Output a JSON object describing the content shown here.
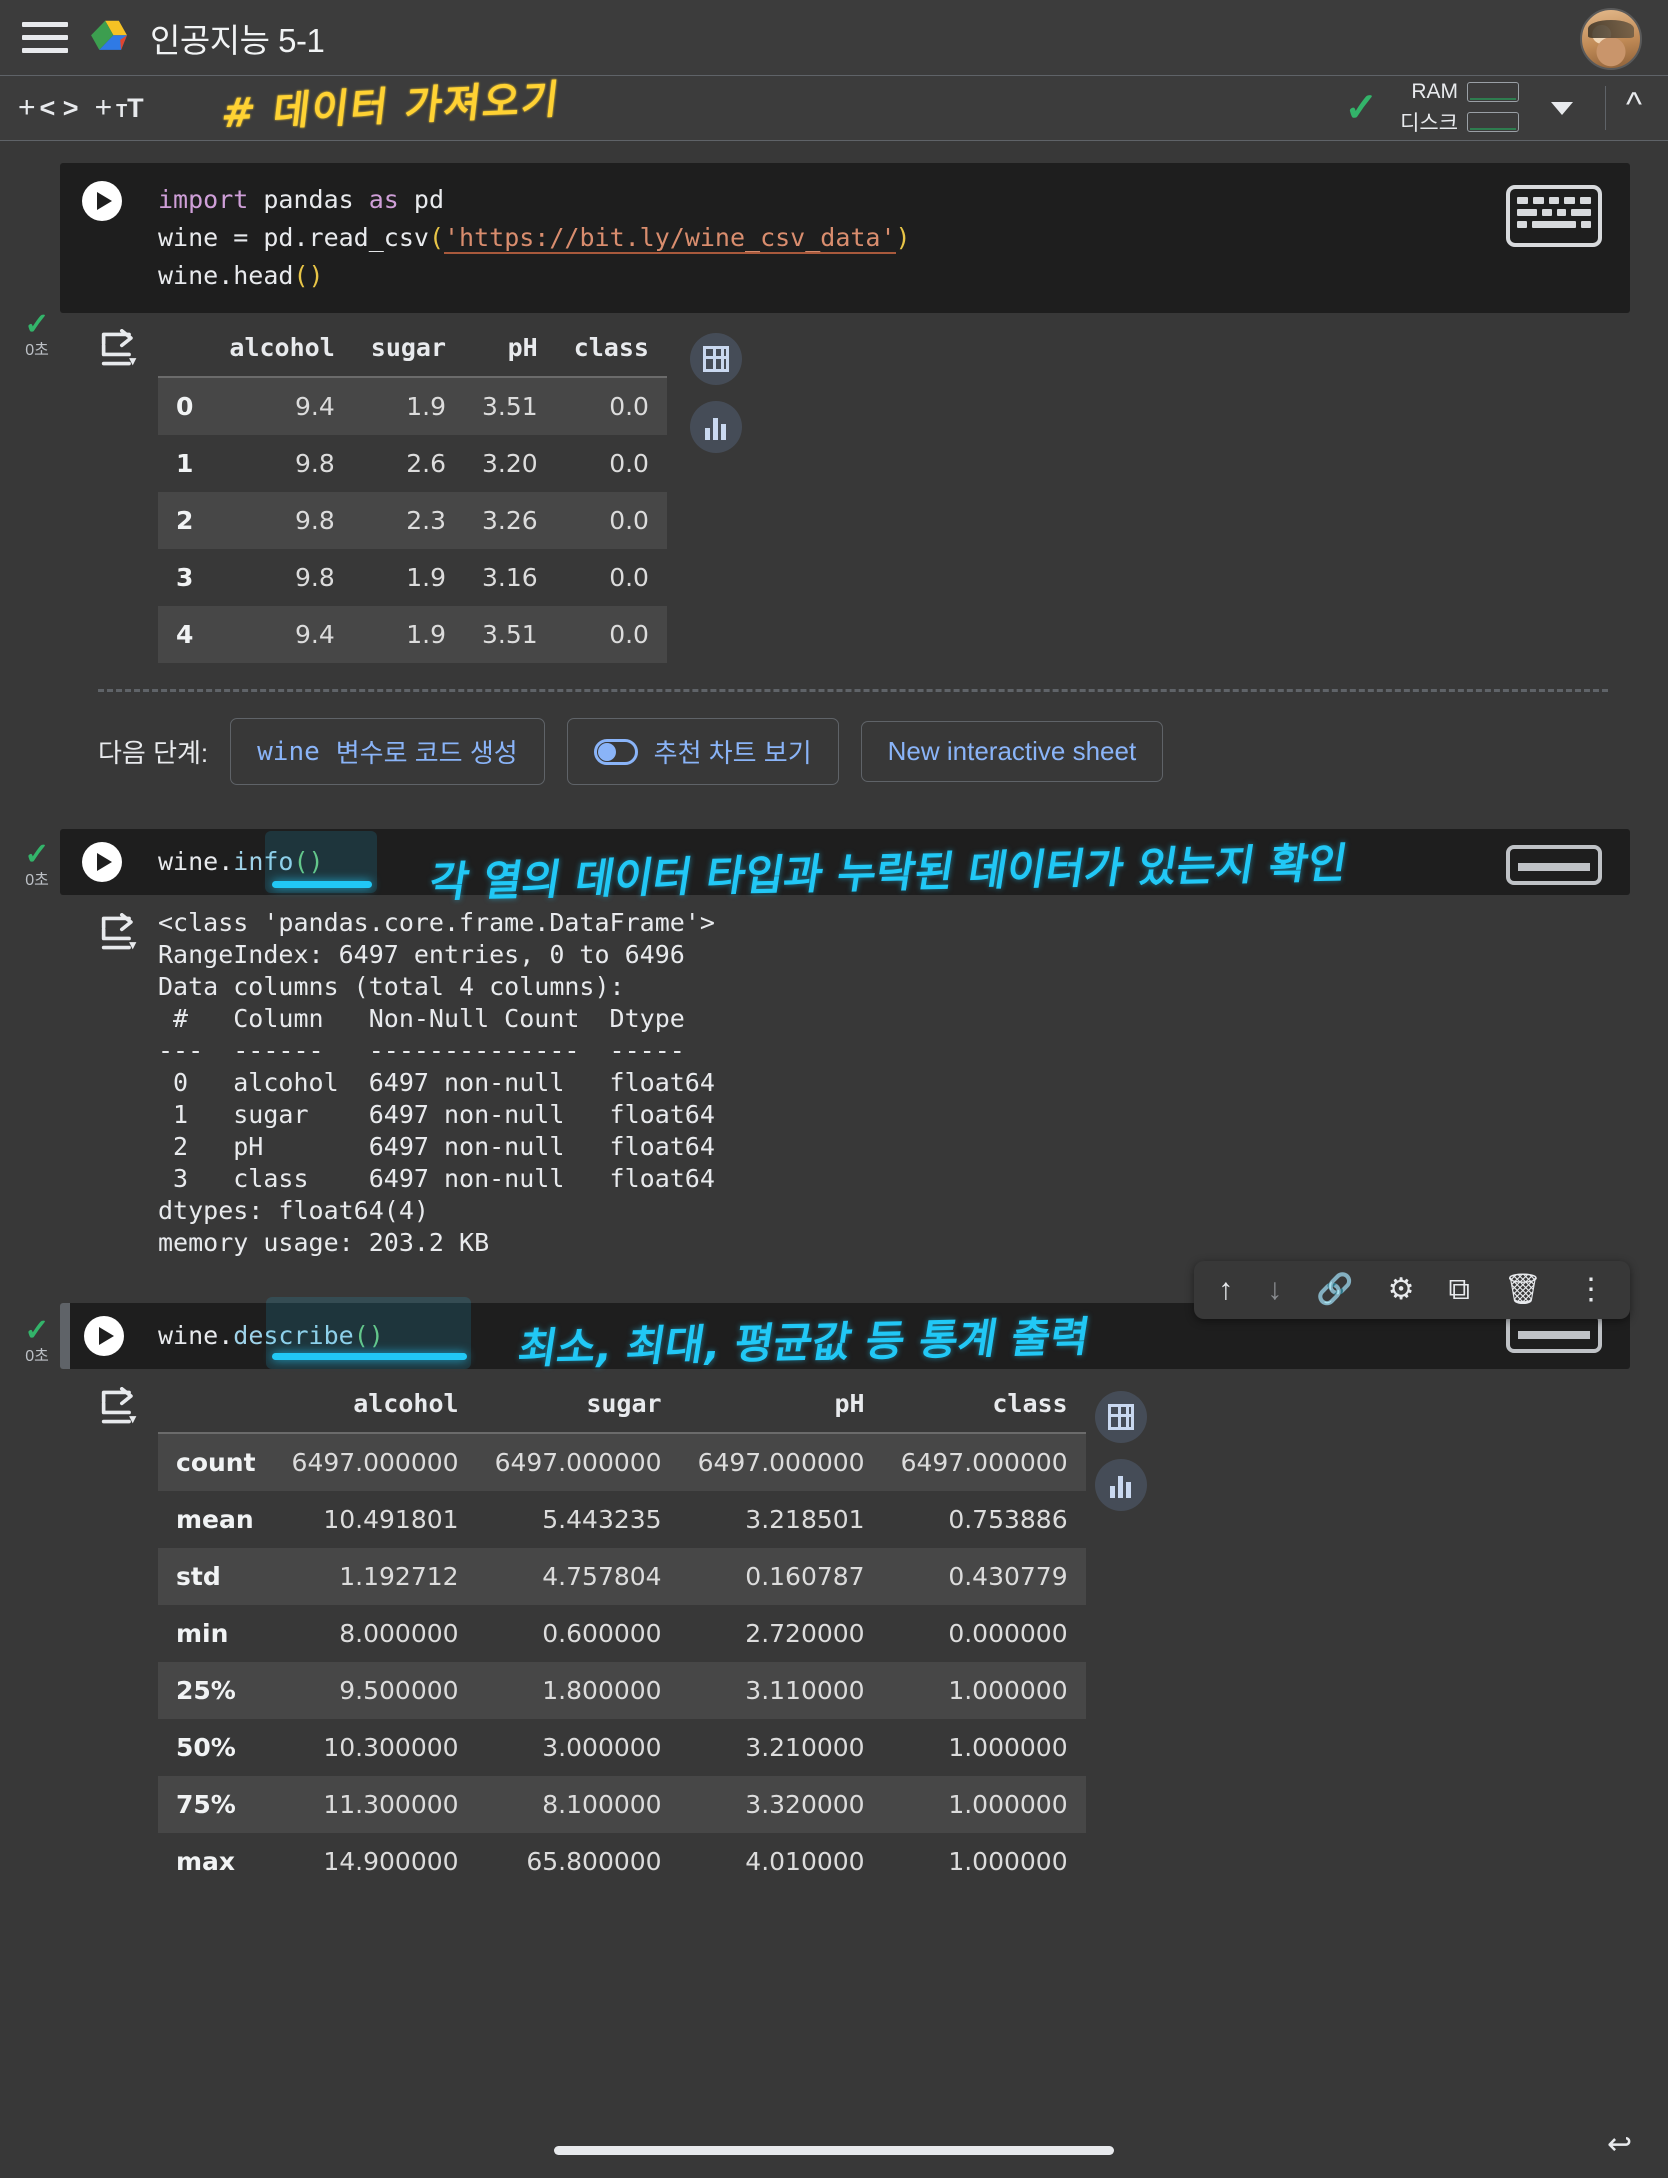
{
  "header": {
    "menu_icon": "hamburger-menu-icon",
    "logo_icon": "google-drive-icon",
    "title": "인공지능 5-1",
    "avatar_icon": "user-avatar"
  },
  "toolbar": {
    "add_code_label": "+",
    "code_glyph": "< >",
    "add_text_label": "+",
    "text_glyph": "T",
    "markdown_heading": "# 데이터 가져오기",
    "status_check_icon": "connected-check-icon",
    "ram_label": "RAM",
    "disk_label": "디스크",
    "dropdown_icon": "chevron-down-icon",
    "collapse_icon": "chevron-up-icon"
  },
  "cells": [
    {
      "status_icon": "success-check-icon",
      "exec_time": "0초",
      "run_icon": "run-cell-icon",
      "keyboard_icon": "keyboard-icon",
      "code_lines": [
        {
          "kw": "import",
          "rest": " pandas ",
          "kw2": "as",
          "rest2": " pd"
        }
      ],
      "code_text_1": "import",
      "code_text_2": " pandas ",
      "code_text_3": "as",
      "code_text_4": " pd",
      "code_line2_pre": "wine = pd.read_csv",
      "code_line2_paren_open": "(",
      "code_line2_str": "'https://bit.ly/wine_csv_data'",
      "code_line2_paren_close": ")",
      "code_line3_pre": "wine.head",
      "code_line3_parens": "()"
    },
    {
      "status_icon": "success-check-icon",
      "exec_time": "0초",
      "run_icon": "run-cell-icon",
      "code_obj": "wine.",
      "code_fn": "info",
      "code_parens": "()",
      "annotation": "각 열의 데이터 타입과 누락된 데이터가 있는지 확인"
    },
    {
      "status_icon": "success-check-icon",
      "exec_time": "0초",
      "run_icon": "run-cell-icon",
      "code_obj": "wine.",
      "code_fn": "describe",
      "code_parens": "()",
      "annotation": "최소, 최대, 평균값 등 통계 출력"
    }
  ],
  "head_output": {
    "output_icon": "output-expand-icon",
    "columns": [
      "",
      "alcohol",
      "sugar",
      "pH",
      "class"
    ],
    "rows": [
      [
        "0",
        "9.4",
        "1.9",
        "3.51",
        "0.0"
      ],
      [
        "1",
        "9.8",
        "2.6",
        "3.20",
        "0.0"
      ],
      [
        "2",
        "9.8",
        "2.3",
        "3.26",
        "0.0"
      ],
      [
        "3",
        "9.8",
        "1.9",
        "3.16",
        "0.0"
      ],
      [
        "4",
        "9.4",
        "1.9",
        "3.51",
        "0.0"
      ]
    ],
    "sheet_icon": "interactive-sheet-icon",
    "chart_icon": "suggested-chart-icon"
  },
  "next_steps": {
    "label": "다음 단계:",
    "generate_code_btn": "wine변수로 코드 생성",
    "generate_code_prefix": "wine",
    "generate_code_suffix": "변수로 코드 생성",
    "chart_btn": "추천 차트 보기",
    "chart_toggle_icon": "toggle-icon",
    "sheet_btn": "New interactive sheet"
  },
  "info_output": {
    "output_icon": "output-expand-icon",
    "text": "<class 'pandas.core.frame.DataFrame'>\nRangeIndex: 6497 entries, 0 to 6496\nData columns (total 4 columns):\n #   Column   Non-Null Count  Dtype\n---  ------   --------------  -----\n 0   alcohol  6497 non-null   float64\n 1   sugar    6497 non-null   float64\n 2   pH       6497 non-null   float64\n 3   class    6497 non-null   float64\ndtypes: float64(4)\nmemory usage: 203.2 KB"
  },
  "cell_toolbar": {
    "move_up_icon": "arrow-up-icon",
    "move_down_icon": "arrow-down-icon",
    "link_icon": "link-icon",
    "settings_icon": "gear-icon",
    "mirror_icon": "mirror-cell-icon",
    "delete_icon": "trash-icon",
    "more_icon": "more-vertical-icon"
  },
  "describe_output": {
    "output_icon": "output-expand-icon",
    "columns": [
      "",
      "alcohol",
      "sugar",
      "pH",
      "class"
    ],
    "rows": [
      [
        "count",
        "6497.000000",
        "6497.000000",
        "6497.000000",
        "6497.000000"
      ],
      [
        "mean",
        "10.491801",
        "5.443235",
        "3.218501",
        "0.753886"
      ],
      [
        "std",
        "1.192712",
        "4.757804",
        "0.160787",
        "0.430779"
      ],
      [
        "min",
        "8.000000",
        "0.600000",
        "2.720000",
        "0.000000"
      ],
      [
        "25%",
        "9.500000",
        "1.800000",
        "3.110000",
        "1.000000"
      ],
      [
        "50%",
        "10.300000",
        "3.000000",
        "3.210000",
        "1.000000"
      ],
      [
        "75%",
        "11.300000",
        "8.100000",
        "3.320000",
        "1.000000"
      ],
      [
        "max",
        "14.900000",
        "65.800000",
        "4.010000",
        "1.000000"
      ]
    ],
    "sheet_icon": "interactive-sheet-icon",
    "chart_icon": "suggested-chart-icon"
  },
  "bottom": {
    "home_indicator": "home-indicator",
    "back_icon": "back-gesture-icon"
  },
  "colors": {
    "background": "#383838",
    "cell_background": "#1e1e1e",
    "accent_blue": "#8ab4f8",
    "handwriting_cyan": "#21c8f6",
    "handwriting_yellow": "#ffd233",
    "success_green": "#33b46a"
  }
}
